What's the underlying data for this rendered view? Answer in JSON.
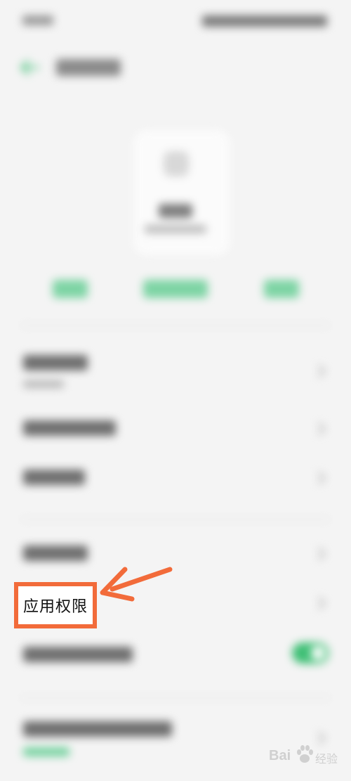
{
  "permissions_row": {
    "label": "应用权限"
  },
  "colors": {
    "accent_green": "#3fbf75",
    "highlight_orange": "#f26b3a",
    "background": "#f4f4f4"
  },
  "icons": [
    "back-arrow-icon",
    "chevron-right-icon",
    "toggle-switch",
    "annotation-arrow",
    "baidu-paw-icon"
  ],
  "toggle": {
    "state": "on"
  },
  "watermark": {
    "brand": "Bai",
    "product": "经验"
  }
}
